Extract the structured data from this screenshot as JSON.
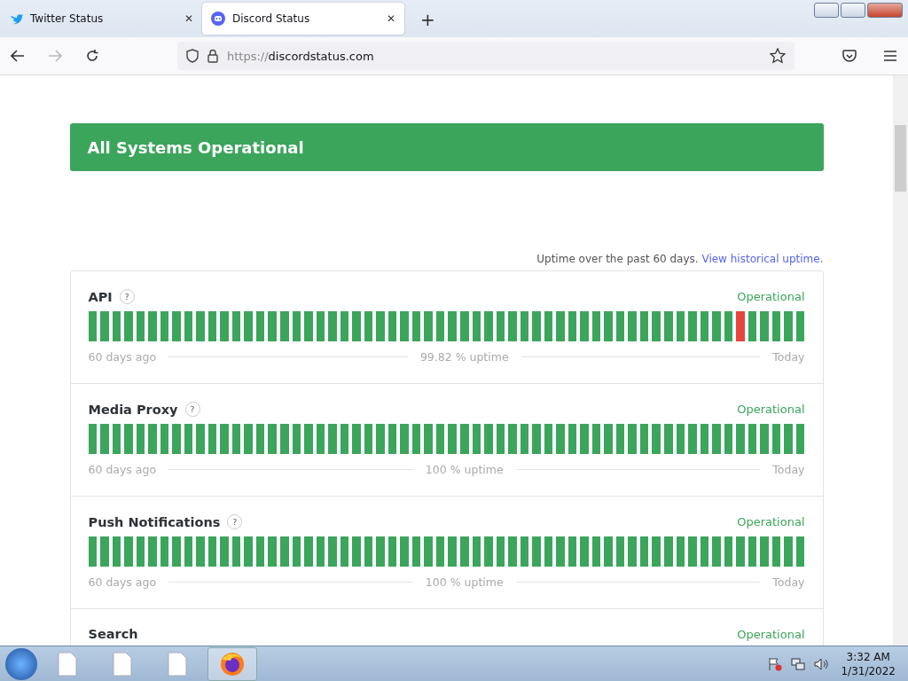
{
  "tabs": [
    {
      "label": "Twitter Status",
      "selected": false,
      "close": "✕"
    },
    {
      "label": "Discord Status",
      "selected": true,
      "close": "✕"
    }
  ],
  "new_tab": "+",
  "address_bar": {
    "scheme": "https://",
    "host": "discordstatus.com"
  },
  "banner": {
    "title": "All Systems Operational"
  },
  "uptime_note": {
    "text": "Uptime over the past 60 days.",
    "link": "View historical uptime."
  },
  "components": [
    {
      "name": "API",
      "help": "?",
      "status": "Operational",
      "start": "60 days ago",
      "uptime": "99.82 % uptime",
      "end": "Today",
      "days": [
        {
          "color": "#3ba55c"
        },
        {
          "color": "#3ba55c"
        },
        {
          "color": "#3ba55c"
        },
        {
          "color": "#3ba55c"
        },
        {
          "color": "#3ba55c"
        },
        {
          "color": "#3ba55c"
        },
        {
          "color": "#3ba55c"
        },
        {
          "color": "#3ba55c"
        },
        {
          "color": "#3ba55c"
        },
        {
          "color": "#3ba55c"
        },
        {
          "color": "#3ba55c"
        },
        {
          "color": "#3ba55c"
        },
        {
          "color": "#3ba55c"
        },
        {
          "color": "#3ba55c"
        },
        {
          "color": "#3ba55c"
        },
        {
          "color": "#3ba55c"
        },
        {
          "color": "#3ba55c"
        },
        {
          "color": "#3ba55c"
        },
        {
          "color": "#3ba55c"
        },
        {
          "color": "#3ba55c"
        },
        {
          "color": "#3ba55c"
        },
        {
          "color": "#3ba55c"
        },
        {
          "color": "#3ba55c"
        },
        {
          "color": "#3ba55c"
        },
        {
          "color": "#3ba55c"
        },
        {
          "color": "#3ba55c"
        },
        {
          "color": "#3ba55c"
        },
        {
          "color": "#3ba55c"
        },
        {
          "color": "#3ba55c"
        },
        {
          "color": "#3ba55c"
        },
        {
          "color": "#3ba55c"
        },
        {
          "color": "#3ba55c"
        },
        {
          "color": "#3ba55c"
        },
        {
          "color": "#3ba55c"
        },
        {
          "color": "#3ba55c"
        },
        {
          "color": "#3ba55c"
        },
        {
          "color": "#3ba55c"
        },
        {
          "color": "#3ba55c"
        },
        {
          "color": "#3ba55c"
        },
        {
          "color": "#3ba55c"
        },
        {
          "color": "#3ba55c"
        },
        {
          "color": "#3ba55c"
        },
        {
          "color": "#3ba55c"
        },
        {
          "color": "#3ba55c"
        },
        {
          "color": "#3ba55c"
        },
        {
          "color": "#3ba55c"
        },
        {
          "color": "#3ba55c"
        },
        {
          "color": "#3ba55c"
        },
        {
          "color": "#3ba55c"
        },
        {
          "color": "#3ba55c"
        },
        {
          "color": "#3ba55c"
        },
        {
          "color": "#3ba55c"
        },
        {
          "color": "#3ba55c"
        },
        {
          "color": "#3ba55c"
        },
        {
          "color": "#e8453c"
        },
        {
          "color": "#3ba55c"
        },
        {
          "color": "#3ba55c"
        },
        {
          "color": "#3ba55c"
        },
        {
          "color": "#3ba55c"
        },
        {
          "color": "#3ba55c"
        }
      ]
    },
    {
      "name": "Media Proxy",
      "help": "?",
      "status": "Operational",
      "start": "60 days ago",
      "uptime": "100 % uptime",
      "end": "Today",
      "days": [
        {
          "color": "#3ba55c"
        },
        {
          "color": "#3ba55c"
        },
        {
          "color": "#3ba55c"
        },
        {
          "color": "#3ba55c"
        },
        {
          "color": "#3ba55c"
        },
        {
          "color": "#3ba55c"
        },
        {
          "color": "#3ba55c"
        },
        {
          "color": "#3ba55c"
        },
        {
          "color": "#3ba55c"
        },
        {
          "color": "#3ba55c"
        },
        {
          "color": "#3ba55c"
        },
        {
          "color": "#3ba55c"
        },
        {
          "color": "#3ba55c"
        },
        {
          "color": "#3ba55c"
        },
        {
          "color": "#3ba55c"
        },
        {
          "color": "#3ba55c"
        },
        {
          "color": "#3ba55c"
        },
        {
          "color": "#3ba55c"
        },
        {
          "color": "#3ba55c"
        },
        {
          "color": "#3ba55c"
        },
        {
          "color": "#3ba55c"
        },
        {
          "color": "#3ba55c"
        },
        {
          "color": "#3ba55c"
        },
        {
          "color": "#3ba55c"
        },
        {
          "color": "#3ba55c"
        },
        {
          "color": "#3ba55c"
        },
        {
          "color": "#3ba55c"
        },
        {
          "color": "#3ba55c"
        },
        {
          "color": "#3ba55c"
        },
        {
          "color": "#3ba55c"
        },
        {
          "color": "#3ba55c"
        },
        {
          "color": "#3ba55c"
        },
        {
          "color": "#3ba55c"
        },
        {
          "color": "#3ba55c"
        },
        {
          "color": "#3ba55c"
        },
        {
          "color": "#3ba55c"
        },
        {
          "color": "#3ba55c"
        },
        {
          "color": "#3ba55c"
        },
        {
          "color": "#3ba55c"
        },
        {
          "color": "#3ba55c"
        },
        {
          "color": "#3ba55c"
        },
        {
          "color": "#3ba55c"
        },
        {
          "color": "#3ba55c"
        },
        {
          "color": "#3ba55c"
        },
        {
          "color": "#3ba55c"
        },
        {
          "color": "#3ba55c"
        },
        {
          "color": "#3ba55c"
        },
        {
          "color": "#3ba55c"
        },
        {
          "color": "#3ba55c"
        },
        {
          "color": "#3ba55c"
        },
        {
          "color": "#3ba55c"
        },
        {
          "color": "#3ba55c"
        },
        {
          "color": "#3ba55c"
        },
        {
          "color": "#3ba55c"
        },
        {
          "color": "#3ba55c"
        },
        {
          "color": "#3ba55c"
        },
        {
          "color": "#3ba55c"
        },
        {
          "color": "#3ba55c"
        },
        {
          "color": "#3ba55c"
        },
        {
          "color": "#3ba55c"
        }
      ]
    },
    {
      "name": "Push Notifications",
      "help": "?",
      "status": "Operational",
      "start": "60 days ago",
      "uptime": "100 % uptime",
      "end": "Today",
      "days": [
        {
          "color": "#3ba55c"
        },
        {
          "color": "#3ba55c"
        },
        {
          "color": "#3ba55c"
        },
        {
          "color": "#3ba55c"
        },
        {
          "color": "#3ba55c"
        },
        {
          "color": "#3ba55c"
        },
        {
          "color": "#3ba55c"
        },
        {
          "color": "#3ba55c"
        },
        {
          "color": "#3ba55c"
        },
        {
          "color": "#3ba55c"
        },
        {
          "color": "#3ba55c"
        },
        {
          "color": "#3ba55c"
        },
        {
          "color": "#3ba55c"
        },
        {
          "color": "#3ba55c"
        },
        {
          "color": "#3ba55c"
        },
        {
          "color": "#3ba55c"
        },
        {
          "color": "#3ba55c"
        },
        {
          "color": "#3ba55c"
        },
        {
          "color": "#3ba55c"
        },
        {
          "color": "#3ba55c"
        },
        {
          "color": "#3ba55c"
        },
        {
          "color": "#3ba55c"
        },
        {
          "color": "#3ba55c"
        },
        {
          "color": "#3ba55c"
        },
        {
          "color": "#3ba55c"
        },
        {
          "color": "#3ba55c"
        },
        {
          "color": "#3ba55c"
        },
        {
          "color": "#3ba55c"
        },
        {
          "color": "#3ba55c"
        },
        {
          "color": "#3ba55c"
        },
        {
          "color": "#3ba55c"
        },
        {
          "color": "#3ba55c"
        },
        {
          "color": "#3ba55c"
        },
        {
          "color": "#3ba55c"
        },
        {
          "color": "#3ba55c"
        },
        {
          "color": "#3ba55c"
        },
        {
          "color": "#3ba55c"
        },
        {
          "color": "#3ba55c"
        },
        {
          "color": "#3ba55c"
        },
        {
          "color": "#3ba55c"
        },
        {
          "color": "#3ba55c"
        },
        {
          "color": "#3ba55c"
        },
        {
          "color": "#3ba55c"
        },
        {
          "color": "#3ba55c"
        },
        {
          "color": "#3ba55c"
        },
        {
          "color": "#3ba55c"
        },
        {
          "color": "#3ba55c"
        },
        {
          "color": "#3ba55c"
        },
        {
          "color": "#3ba55c"
        },
        {
          "color": "#3ba55c"
        },
        {
          "color": "#3ba55c"
        },
        {
          "color": "#3ba55c"
        },
        {
          "color": "#3ba55c"
        },
        {
          "color": "#3ba55c"
        },
        {
          "color": "#3ba55c"
        },
        {
          "color": "#3ba55c"
        },
        {
          "color": "#3ba55c"
        },
        {
          "color": "#3ba55c"
        },
        {
          "color": "#3ba55c"
        },
        {
          "color": "#3ba55c"
        }
      ]
    },
    {
      "name": "Search",
      "status": "Operational"
    }
  ],
  "taskbar": {
    "time": "3:32 AM",
    "date": "1/31/2022"
  }
}
